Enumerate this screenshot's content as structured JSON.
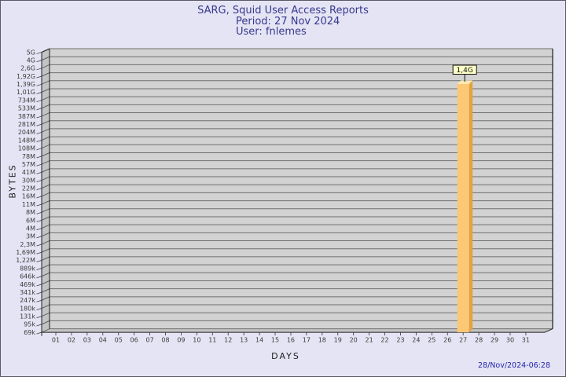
{
  "header": {
    "title": "SARG, Squid User Access Reports",
    "period": "Period: 27 Nov 2024",
    "user": "User: fnlemes"
  },
  "footer": {
    "timestamp": "28/Nov/2024-06:28"
  },
  "colors": {
    "background": "#e4e4f4",
    "plot_background": "#d2d2d2",
    "wall": "#c3c3c3",
    "gridline": "#6f6f6f",
    "frame": "#1f1f1f",
    "tick_text": "#3a3a3a",
    "title_text": "#38388e",
    "timestamp_text": "#2424ac",
    "bar_front": "#fdc874",
    "bar_side": "#e2a23f",
    "bar_top": "#ffe8b5",
    "bar_label_background": "#ffffc8"
  },
  "chart_data": {
    "type": "bar",
    "projection": "3d",
    "title": "SARG, Squid User Access Reports",
    "subtitle_period": "Period: 27 Nov 2024",
    "subtitle_user": "User: fnlemes",
    "xlabel": "DAYS",
    "ylabel": "BYTES",
    "y_scale": "log",
    "ylim_bytes": [
      69000,
      5000000000
    ],
    "grid": true,
    "legend_position": "none",
    "y_tick_labels": [
      "5G",
      "4G",
      "2,6G",
      "1,92G",
      "1,39G",
      "1,01G",
      "734M",
      "533M",
      "387M",
      "281M",
      "204M",
      "148M",
      "108M",
      "78M",
      "57M",
      "41M",
      "30M",
      "22M",
      "16M",
      "11M",
      "8M",
      "6M",
      "4M",
      "3M",
      "2,3M",
      "1,69M",
      "1,22M",
      "889k",
      "646k",
      "469k",
      "341k",
      "247k",
      "180k",
      "131k",
      "95k",
      "69k"
    ],
    "x_categories": [
      "01",
      "02",
      "03",
      "04",
      "05",
      "06",
      "07",
      "08",
      "09",
      "10",
      "11",
      "12",
      "13",
      "14",
      "15",
      "16",
      "17",
      "18",
      "19",
      "20",
      "21",
      "22",
      "23",
      "24",
      "25",
      "26",
      "27",
      "28",
      "29",
      "30",
      "31"
    ],
    "series": [
      {
        "name": "bytes",
        "data": [
          {
            "day": "27",
            "value_bytes": 1400000000,
            "value_label": "1,4G"
          }
        ]
      }
    ]
  }
}
